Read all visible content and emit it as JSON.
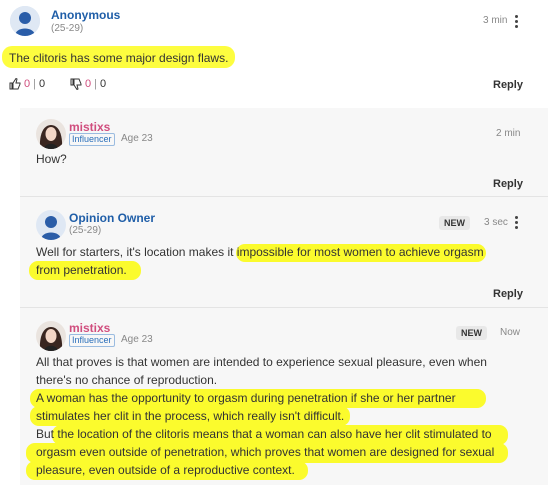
{
  "main_post": {
    "author": "Anonymous",
    "age": "(25-29)",
    "time": "3 min",
    "text": "The clitoris has some major design flaws.",
    "likes": "0",
    "like_sep": "|",
    "like_count2": "0",
    "dislikes": "0",
    "dislike_sep": "|",
    "dislike_count2": "0",
    "reply_label": "Reply"
  },
  "replies": [
    {
      "author": "mistixs",
      "badge": "Influencer",
      "age": "Age 23",
      "time": "2 min",
      "text": "How?",
      "reply_label": "Reply"
    },
    {
      "author": "Opinion Owner",
      "age": "(25-29)",
      "tag": "NEW",
      "time": "3 sec",
      "text_a": "Well for starters, it's location makes it ",
      "text_b": "impossible for most women to achieve orgasm",
      "text_c": "from penetration.",
      "reply_label": "Reply"
    },
    {
      "author": "mistixs",
      "badge": "Influencer",
      "age": "Age 23",
      "tag": "NEW",
      "time": "Now",
      "line1": "All that proves is that women are intended to experience sexual pleasure, even when",
      "line2": "there's no chance of reproduction.",
      "line3": "A woman has the opportunity to orgasm during penetration if she or her partner",
      "line4": "stimulates her clit in the process, which really isn't difficult.",
      "line5a": "But ",
      "line5b": "the location of the clitoris means that a woman can also have her clit stimulated to",
      "line6": "orgasm even outside of penetration, which proves that women are designed for sexual",
      "line7": "pleasure, even outside of a reproductive context."
    }
  ],
  "colors": {
    "author_blue": "#1f5ea8",
    "author_pink": "#d04e7e",
    "highlight": "#fdfd3f"
  },
  "icons": [
    "user-silhouette-icon",
    "thumbs-up-icon",
    "thumbs-down-icon",
    "more-vertical-icon",
    "avatar-photo"
  ]
}
